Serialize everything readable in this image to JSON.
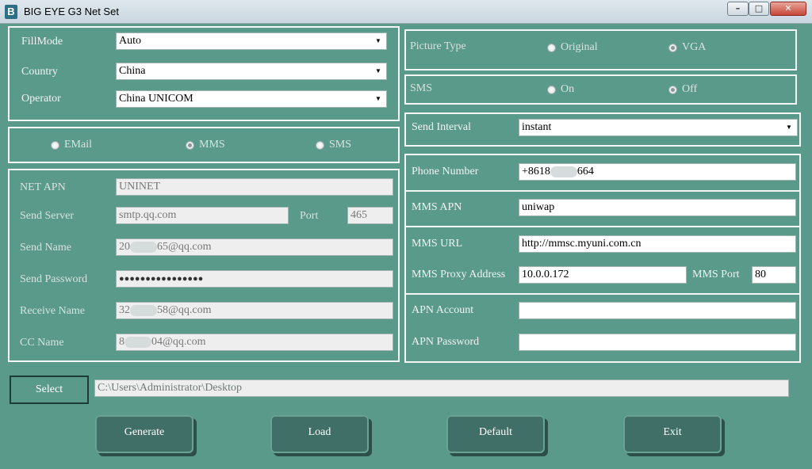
{
  "window": {
    "title": "BIG EYE G3 Net Set",
    "icon_letter": "B",
    "buttons": {
      "minimize": "–",
      "maximize": "□",
      "close": "✕"
    }
  },
  "left_top": {
    "fillmode_label": "FillMode",
    "fillmode_value": "Auto",
    "country_label": "Country",
    "country_value": "China",
    "operator_label": "Operator",
    "operator_value": "China UNICOM"
  },
  "mode": {
    "options": [
      "EMail",
      "MMS",
      "SMS"
    ],
    "selected": "MMS"
  },
  "email": {
    "net_apn_label": "NET APN",
    "net_apn_value": "UNINET",
    "send_server_label": "Send Server",
    "send_server_value": "smtp.qq.com",
    "port_label": "Port",
    "port_value": "465",
    "send_name_label": "Send Name",
    "send_name_prefix": "20",
    "send_name_suffix": "65@qq.com",
    "send_password_label": "Send Password",
    "send_password_value": "●●●●●●●●●●●●●●●●",
    "receive_name_label": "Receive Name",
    "receive_name_prefix": "32",
    "receive_name_suffix": "58@qq.com",
    "cc_name_label": "CC Name",
    "cc_name_prefix": "8",
    "cc_name_suffix": "04@qq.com"
  },
  "picture": {
    "label": "Picture Type",
    "options": [
      "Original",
      "VGA"
    ],
    "selected": "VGA"
  },
  "sms": {
    "label": "SMS",
    "options": [
      "On",
      "Off"
    ],
    "selected": "Off"
  },
  "interval": {
    "label": "Send Interval",
    "value": "instant"
  },
  "mms": {
    "phone_label": "Phone Number",
    "phone_prefix": "+8618",
    "phone_suffix": "664",
    "apn_label": "MMS APN",
    "apn_value": "uniwap",
    "url_label": "MMS URL",
    "url_value": "http://mmsc.myuni.com.cn",
    "proxy_label": "MMS Proxy Address",
    "proxy_value": "10.0.0.172",
    "port_label": "MMS Port",
    "port_value": "80",
    "apn_account_label": "APN Account",
    "apn_account_value": "",
    "apn_password_label": "APN Password",
    "apn_password_value": ""
  },
  "path": {
    "select_label": "Select",
    "value": "C:\\Users\\Administrator\\Desktop"
  },
  "actions": {
    "generate": "Generate",
    "load": "Load",
    "default": "Default",
    "exit": "Exit"
  },
  "colors": {
    "background": "#5a9a8a",
    "button": "#3f6f66",
    "border": "#f3f6f5"
  }
}
